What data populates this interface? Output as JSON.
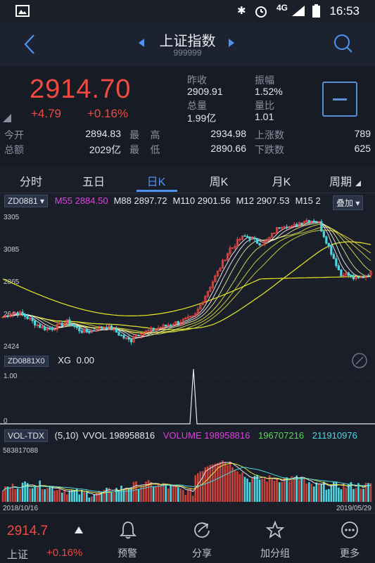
{
  "status_bar": {
    "time": "16:53",
    "network": "4G"
  },
  "header": {
    "title": "上证指数",
    "code": "999999"
  },
  "quote": {
    "price": "2914.70",
    "change": "+4.79",
    "change_pct": "+0.16%",
    "prev_close_label": "昨收",
    "prev_close": "2909.91",
    "amplitude_label": "振幅",
    "amplitude": "1.52%",
    "volume_label": "总量",
    "volume": "1.99亿",
    "vol_ratio_label": "量比",
    "vol_ratio": "1.01",
    "open_label": "今开",
    "open": "2894.83",
    "high_label": "最    高",
    "high": "2934.98",
    "up_count_label": "上涨数",
    "up_count": "789",
    "amount_label": "总额",
    "amount": "2029亿",
    "low_label": "最    低",
    "low": "2890.66",
    "down_count_label": "下跌数",
    "down_count": "625"
  },
  "tabs": [
    "分时",
    "五日",
    "日K",
    "周K",
    "月K",
    "周期"
  ],
  "main_indicator": {
    "name": "ZD0881",
    "items": [
      {
        "label": "M55",
        "value": "2884.50",
        "color": "#e040e0"
      },
      {
        "label": "M88",
        "value": "2897.72",
        "color": "#e6e8ee"
      },
      {
        "label": "M110",
        "value": "2901.56",
        "color": "#e6e8ee"
      },
      {
        "label": "M12",
        "value": "2907.53",
        "color": "#e6e8ee"
      },
      {
        "label": "M15",
        "value": "2",
        "color": "#e6e8ee"
      }
    ],
    "overlay_button": "叠加",
    "y_ticks": [
      "3305",
      "3085",
      "2865",
      "2644",
      "2424"
    ]
  },
  "sub_indicator": {
    "name": "ZD0881X0",
    "label": "XG",
    "value": "0.00",
    "y_ticks": [
      "1.00",
      "0"
    ]
  },
  "volume_indicator": {
    "name": "VOL-TDX",
    "params": "(5,10)",
    "vvol_label": "VVOL",
    "vvol": "198958816",
    "volume_label": "VOLUME",
    "volume": "198958816",
    "ma5": "196707216",
    "ma10": "211910976",
    "y_max": "583817088",
    "date_start": "2018/10/16",
    "date_end": "2019/05/29"
  },
  "bottom_nav": {
    "price": "2914.7",
    "name": "上证",
    "change_pct": "+0.16%",
    "items": [
      {
        "label": "预警",
        "icon": "bell-icon"
      },
      {
        "label": "分享",
        "icon": "share-icon"
      },
      {
        "label": "加分组",
        "icon": "star-icon"
      },
      {
        "label": "更多",
        "icon": "more-icon"
      }
    ]
  },
  "colors": {
    "up": "#f04a43",
    "down": "#4fd6e0",
    "accent": "#4f93f0"
  }
}
